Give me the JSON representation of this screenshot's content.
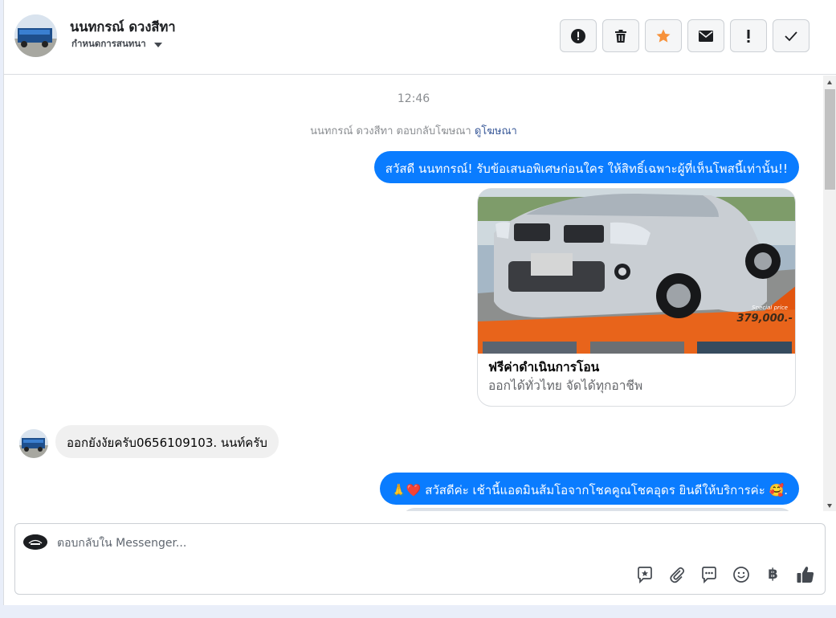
{
  "header": {
    "name": "นนทกรณ์ ดวงสีทา",
    "assign_label": "กำหนดการสนทนา",
    "actions": [
      {
        "icon": "alert-circle-icon"
      },
      {
        "icon": "trash-icon"
      },
      {
        "icon": "star-icon",
        "color": "#f7923b"
      },
      {
        "icon": "envelope-icon"
      },
      {
        "icon": "exclamation-icon"
      },
      {
        "icon": "check-icon"
      }
    ]
  },
  "thread": {
    "timestamp": "12:46",
    "ad_reply_prefix": "นนทกรณ์ ดวงสีทา ตอบกลับโฆษณา",
    "ad_reply_link": "ดูโฆษณา",
    "outgoing_1": "สวัสดี นนทกรณ์! รับข้อเสนอพิเศษก่อนใคร ให้สิทธิ์เฉพาะผู้ที่เห็นโพสนี้เท่านั้น!!",
    "ad_card": {
      "special_price_label": "Special price",
      "price": "379,000.-",
      "title": "ฟรีค่าดำเนินการโอน",
      "subtitle": "ออกได้ทั่วไทย จัดได้ทุกอาชีพ"
    },
    "incoming_1": "ออกยังงัยครับ0656109103. นนท์ครับ",
    "outgoing_2": "🙏❤️ สวัสดีค่ะ เช้านี้แอดมินส้มโอจากโชคคูณโชคอุดร ยินดีให้บริการค่ะ 🥰."
  },
  "composer": {
    "placeholder": "ตอบกลับใน Messenger...",
    "tools": [
      "saved-reply-icon",
      "attachment-icon",
      "chat-bubble-icon",
      "emoji-icon",
      "baht-icon",
      "thumbs-up-icon"
    ],
    "baht_symbol": "฿"
  },
  "colors": {
    "accent": "#0a7cff",
    "incoming_bubble": "#f0f0f0",
    "star": "#f7923b"
  }
}
